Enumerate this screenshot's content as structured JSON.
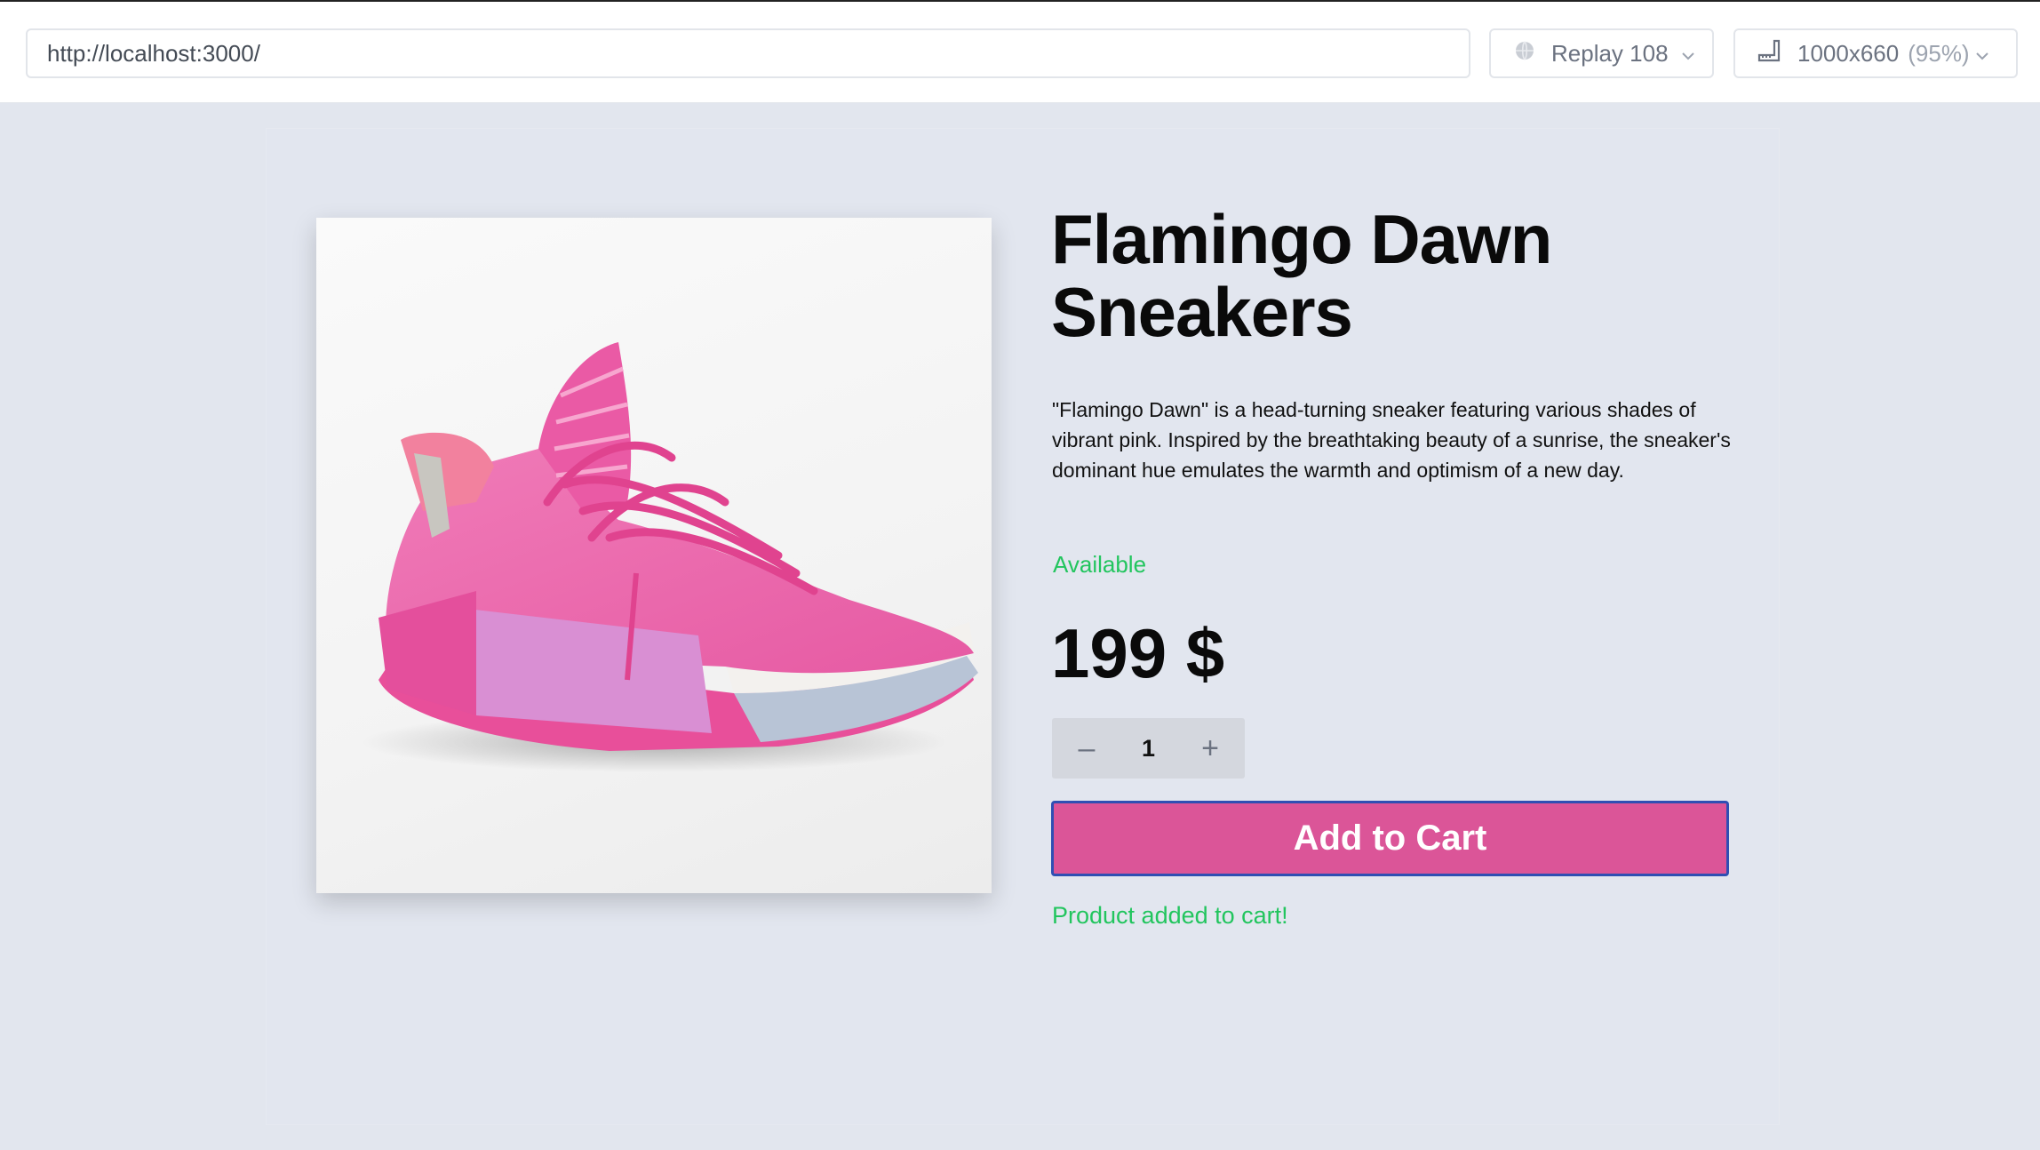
{
  "browser": {
    "url": "http://localhost:3000/",
    "replay_label": "Replay 108",
    "viewport_label": "1000x660",
    "zoom_label": "(95%)"
  },
  "product": {
    "title": "Flamingo Dawn Sneakers",
    "description": "\"Flamingo Dawn\" is a head-turning sneaker featuring various shades of vibrant pink. Inspired by the breathtaking beauty of a sunrise, the sneaker's dominant hue emulates the warmth and optimism of a new day.",
    "availability": "Available",
    "price": "199 $",
    "quantity": "1",
    "decrement_symbol": "–",
    "increment_symbol": "+",
    "add_to_cart_label": "Add to Cart",
    "added_message": "Product added to cart!"
  },
  "colors": {
    "accent_pink": "#db5598",
    "button_border": "#2f4fb3",
    "success_green": "#22c55e"
  },
  "icons": {
    "replay": "globe-icon",
    "viewport": "ruler-icon",
    "dropdown": "chevron-down-icon"
  }
}
